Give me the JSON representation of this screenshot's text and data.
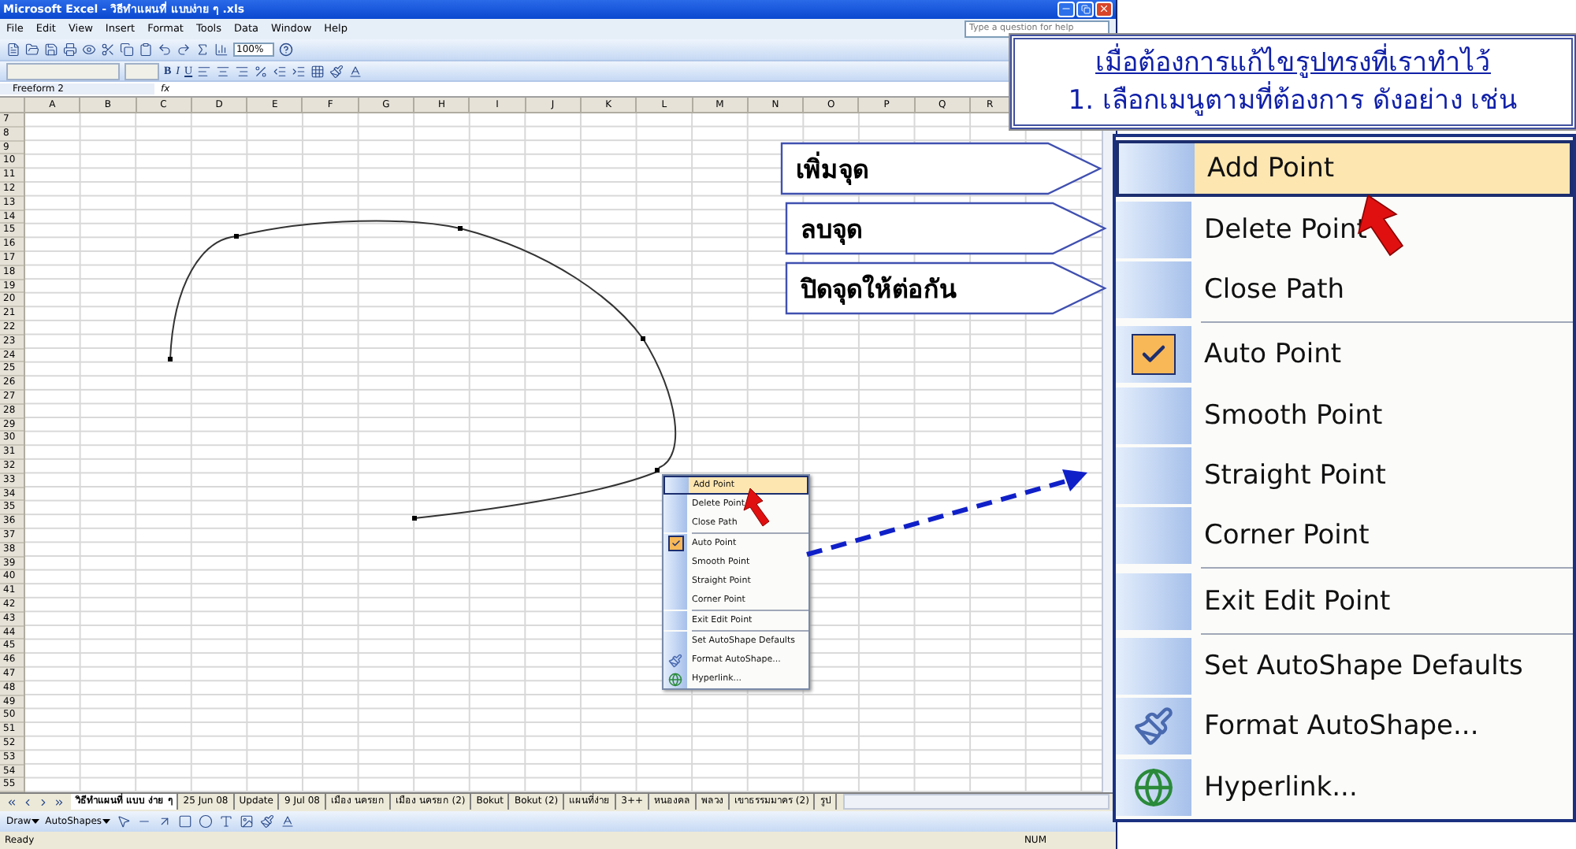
{
  "window": {
    "title": "Microsoft Excel - วิธีทำแผนที่ แบบง่าย ๆ .xls"
  },
  "menu_bar": [
    "File",
    "Edit",
    "View",
    "Insert",
    "Format",
    "Tools",
    "Data",
    "Window",
    "Help"
  ],
  "help_box": {
    "placeholder": "Type a question for help"
  },
  "toolbar": {
    "zoom": "100%"
  },
  "format_toolbar": {
    "bold": "B",
    "italic": "I",
    "underline": "U"
  },
  "formula_bar": {
    "name_box": "Freeform 2",
    "fx": "fx"
  },
  "sheet": {
    "columns": [
      "A",
      "B",
      "C",
      "D",
      "E",
      "F",
      "G",
      "H",
      "I",
      "J",
      "K",
      "L",
      "M",
      "N",
      "O",
      "P",
      "Q",
      "R"
    ],
    "rows": [
      "7",
      "8",
      "9",
      "10",
      "11",
      "12",
      "13",
      "14",
      "15",
      "16",
      "17",
      "18",
      "19",
      "20",
      "21",
      "22",
      "23",
      "24",
      "25",
      "26",
      "27",
      "28",
      "29",
      "30",
      "31",
      "32",
      "33",
      "34",
      "35",
      "36",
      "37",
      "38",
      "39",
      "40",
      "41",
      "42",
      "43",
      "44",
      "45",
      "46",
      "47",
      "48",
      "49",
      "50",
      "51",
      "52",
      "53",
      "54",
      "55"
    ]
  },
  "context_menu": {
    "groups": [
      [
        {
          "label": "Add Point",
          "kind": "text",
          "selected": true,
          "checked": false
        },
        {
          "label": "Delete Point",
          "kind": "text",
          "selected": false,
          "checked": false
        },
        {
          "label": "Close Path",
          "kind": "text",
          "selected": false,
          "checked": false
        }
      ],
      [
        {
          "label": "Auto Point",
          "kind": "text",
          "selected": false,
          "checked": true
        },
        {
          "label": "Smooth Point",
          "kind": "text",
          "selected": false,
          "checked": false
        },
        {
          "label": "Straight Point",
          "kind": "text",
          "selected": false,
          "checked": false
        },
        {
          "label": "Corner Point",
          "kind": "text",
          "selected": false,
          "checked": false
        }
      ],
      [
        {
          "label": "Exit Edit Point",
          "kind": "text",
          "selected": false,
          "checked": false
        }
      ],
      [
        {
          "label": "Set AutoShape Defaults",
          "kind": "text",
          "selected": false,
          "checked": false
        },
        {
          "label": "Format AutoShape...",
          "kind": "format",
          "selected": false,
          "checked": false
        },
        {
          "label": "Hyperlink...",
          "kind": "link",
          "selected": false,
          "checked": false
        }
      ]
    ]
  },
  "sheet_tabs": [
    {
      "label": "วิธีทำแผนที่ แบบ ง่าย ๆ",
      "selected": true
    },
    {
      "label": "25 Jun 08",
      "selected": false
    },
    {
      "label": "Update",
      "selected": false
    },
    {
      "label": "9 Jul 08",
      "selected": false
    },
    {
      "label": "เมือง นครยก",
      "selected": false
    },
    {
      "label": "เมือง นครยก (2)",
      "selected": false
    },
    {
      "label": "Bokut",
      "selected": false
    },
    {
      "label": "Bokut (2)",
      "selected": false
    },
    {
      "label": "แผนที่ง่าย",
      "selected": false
    },
    {
      "label": "3++",
      "selected": false
    },
    {
      "label": "หนองคล",
      "selected": false
    },
    {
      "label": "พลวง",
      "selected": false
    },
    {
      "label": "เขาธรรมมาคร (2)",
      "selected": false
    },
    {
      "label": "รูป",
      "selected": false
    }
  ],
  "drawing_toolbar": {
    "draw": "Draw",
    "autoshapes": "AutoShapes"
  },
  "status_bar": {
    "left": "Ready",
    "right": "NUM"
  },
  "note": {
    "heading": "เมื่อต้องการแก้ไขรูปทรงที่เราทำไว้",
    "line": "1. เลือกเมนูตามที่ต้องการ ดังอย่าง เช่น"
  },
  "callouts": [
    "เพิ่มจุด",
    "ลบจุด",
    "ปิดจุดให้ต่อกัน"
  ],
  "zoomed_menu": {
    "groups": [
      [
        {
          "label": "Add Point",
          "kind": "text",
          "selected": true,
          "checked": false
        },
        {
          "label": "Delete Point",
          "kind": "text",
          "selected": false,
          "checked": false
        },
        {
          "label": "Close Path",
          "kind": "text",
          "selected": false,
          "checked": false
        }
      ],
      [
        {
          "label": "Auto Point",
          "kind": "text",
          "selected": false,
          "checked": true
        },
        {
          "label": "Smooth Point",
          "kind": "text",
          "selected": false,
          "checked": false
        },
        {
          "label": "Straight Point",
          "kind": "text",
          "selected": false,
          "checked": false
        },
        {
          "label": "Corner Point",
          "kind": "text",
          "selected": false,
          "checked": false
        }
      ],
      [
        {
          "label": "Exit Edit Point",
          "kind": "text",
          "selected": false,
          "checked": false
        }
      ],
      [
        {
          "label": "Set AutoShape Defaults",
          "kind": "text",
          "selected": false,
          "checked": false
        },
        {
          "label": "Format AutoShape...",
          "kind": "format",
          "selected": false,
          "checked": false
        },
        {
          "label": "Hyperlink...",
          "kind": "link",
          "selected": false,
          "checked": false
        }
      ]
    ]
  }
}
